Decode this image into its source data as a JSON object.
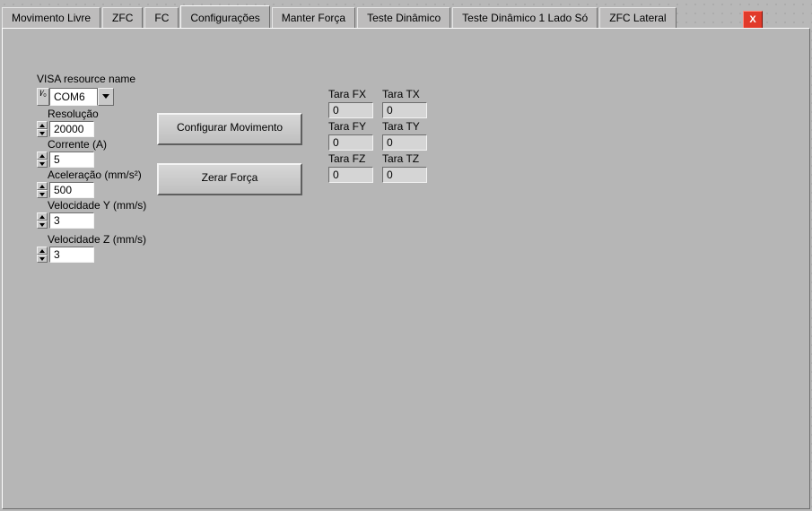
{
  "close_label": "X",
  "tabs": {
    "t0": "Movimento Livre",
    "t1": "ZFC",
    "t2": "FC",
    "t3": "Configurações",
    "t4": "Manter Força",
    "t5": "Teste Dinâmico",
    "t6": "Teste Dinâmico 1 Lado Só",
    "t7": "ZFC Lateral"
  },
  "labels": {
    "visa": "VISA resource name",
    "resolucao": "Resolução",
    "corrente": "Corrente (A)",
    "aceleracao": "Aceleração (mm/s²)",
    "vel_y": "Velocidade Y (mm/s)",
    "vel_z": "Velocidade Z (mm/s)",
    "tara_fx": "Tara FX",
    "tara_fy": "Tara FY",
    "tara_fz": "Tara FZ",
    "tara_tx": "Tara TX",
    "tara_ty": "Tara TY",
    "tara_tz": "Tara TZ"
  },
  "visa": {
    "value": "COM6",
    "io_glyph": "I⁄₀"
  },
  "numerics": {
    "resolucao": "20000",
    "corrente": "5",
    "aceleracao": "500",
    "vel_y": "3",
    "vel_z": "3"
  },
  "indicators": {
    "tara_fx": "0",
    "tara_fy": "0",
    "tara_fz": "0",
    "tara_tx": "0",
    "tara_ty": "0",
    "tara_tz": "0"
  },
  "buttons": {
    "config_mov": "Configurar Movimento",
    "zerar_forca": "Zerar Força"
  }
}
